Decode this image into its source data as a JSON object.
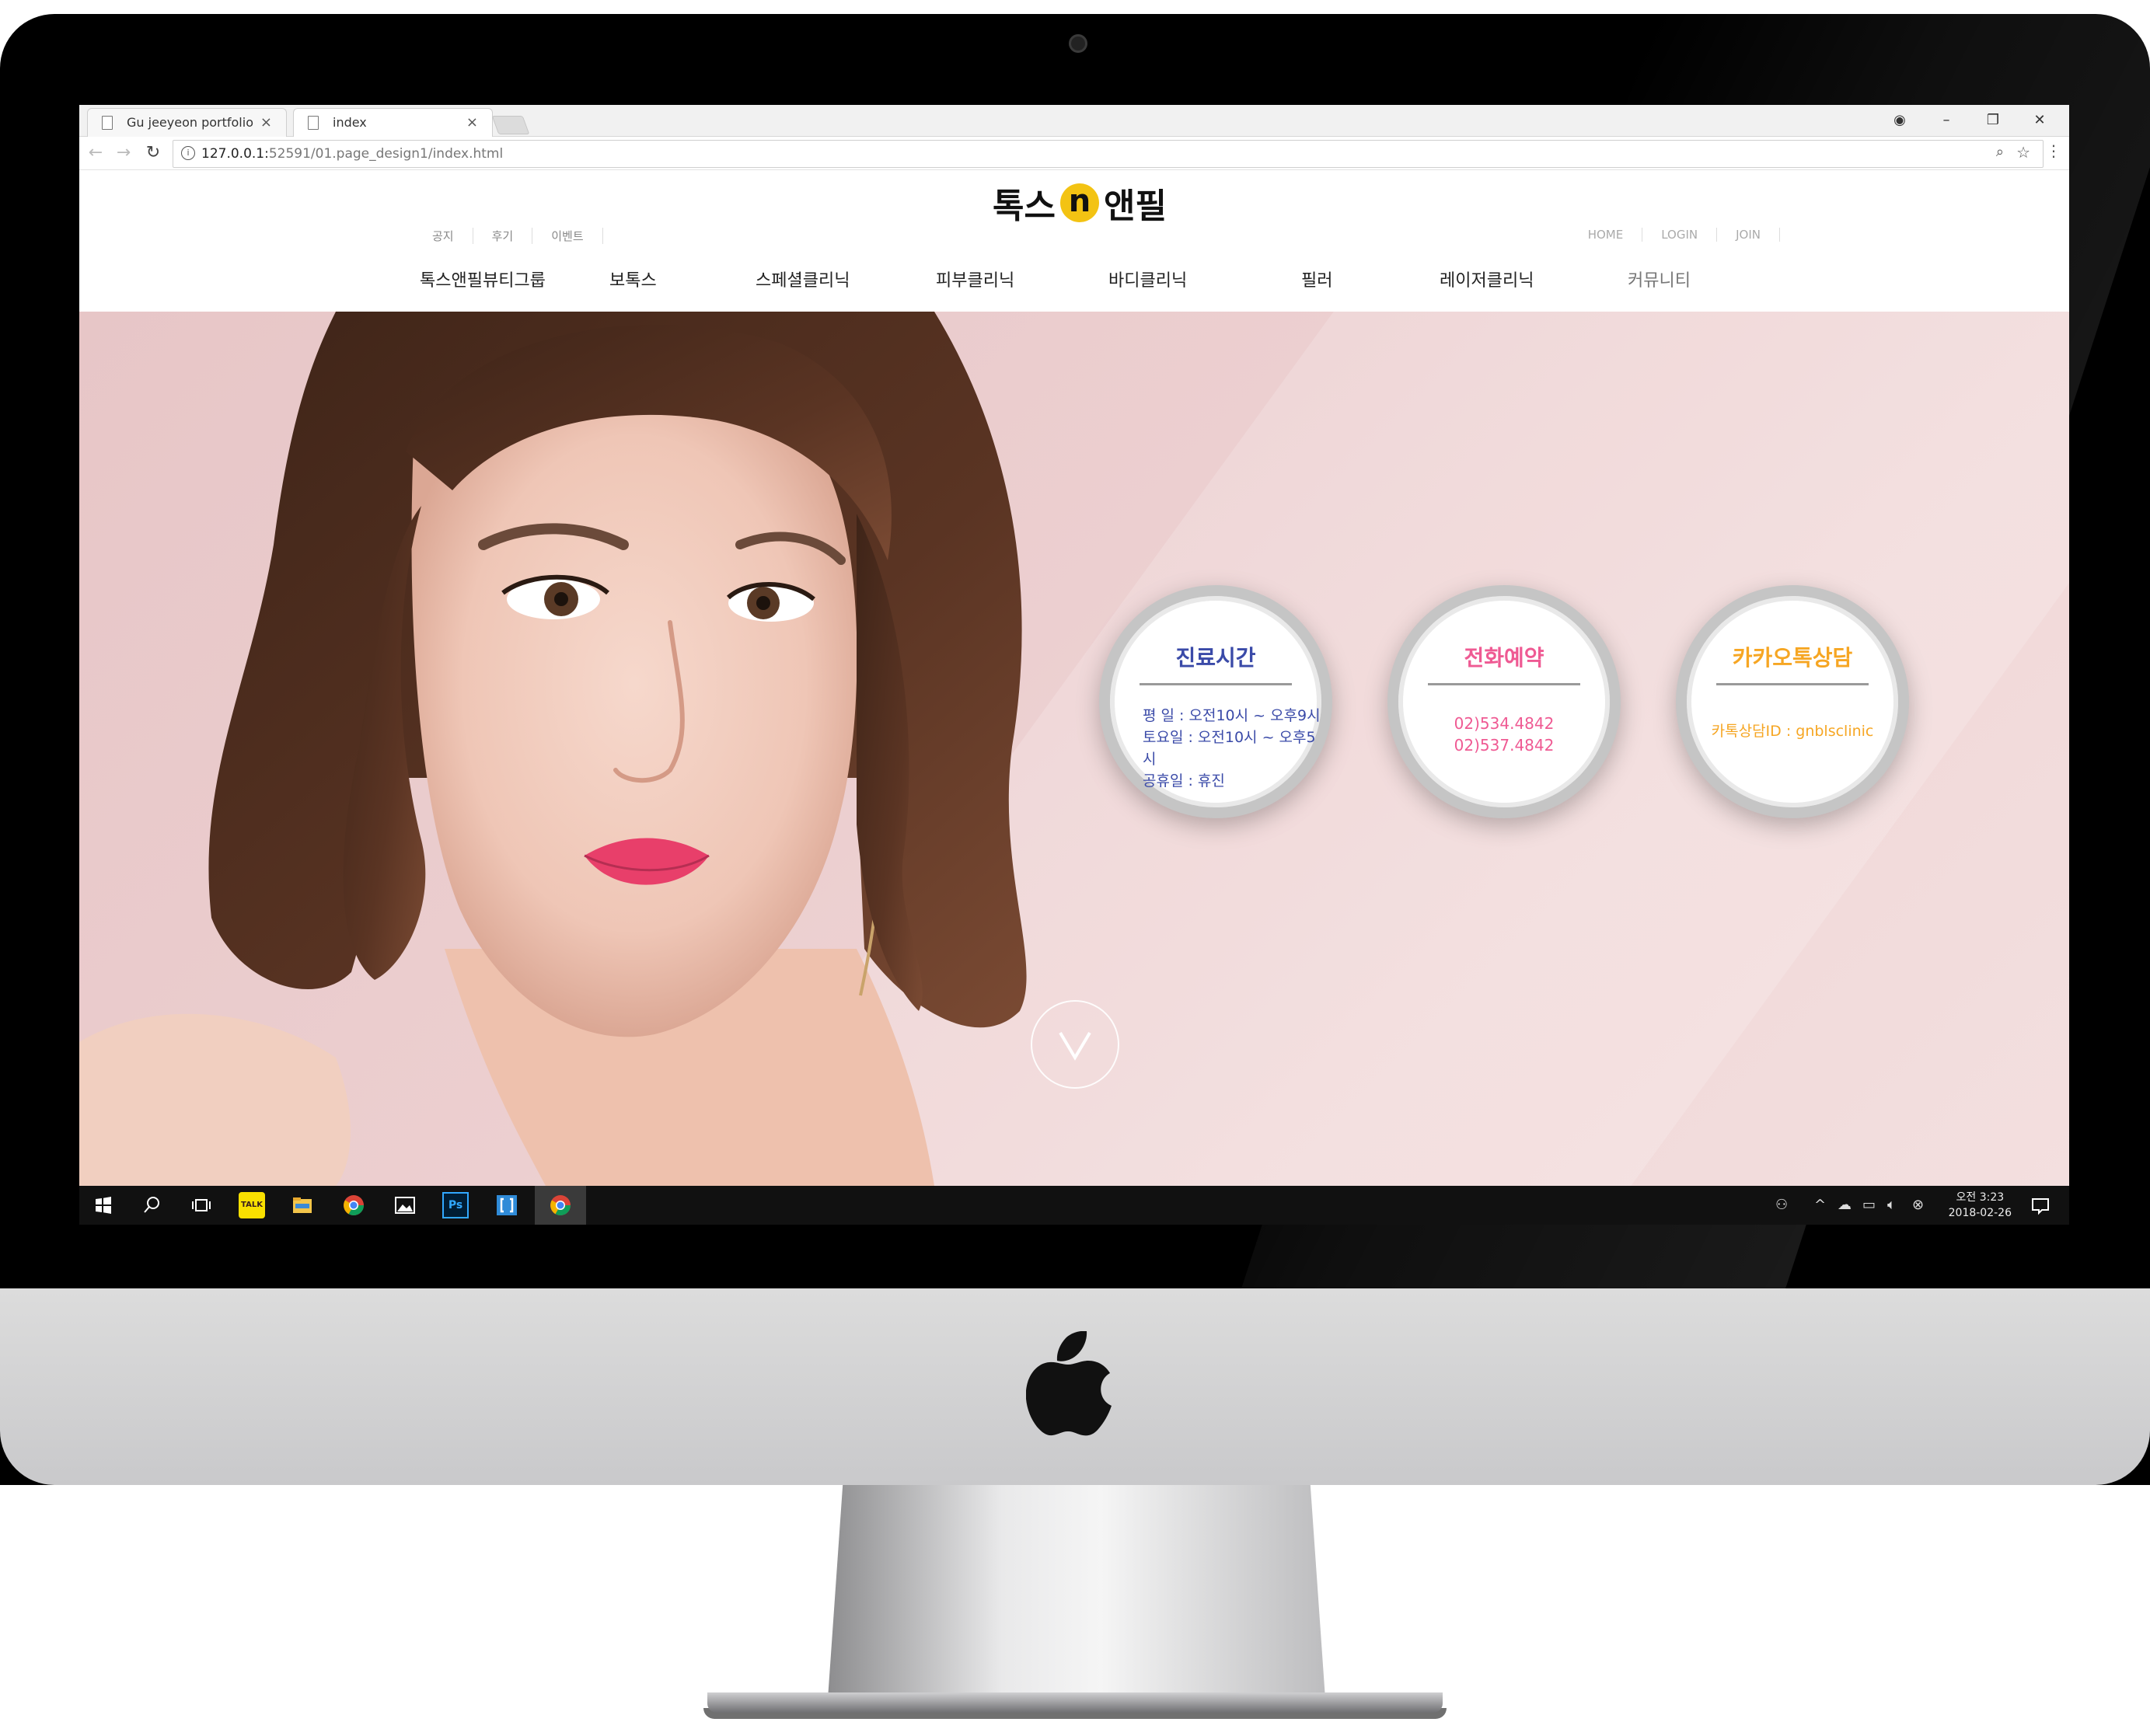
{
  "browser": {
    "tabs": [
      {
        "label": "Gu jeeyeon portfolio",
        "active": false
      },
      {
        "label": "index",
        "active": true
      }
    ],
    "url_host": "127.0.0.1:",
    "url_rest": "52591/01.page_design1/index.html",
    "window_controls": [
      "minimize",
      "restore",
      "close"
    ]
  },
  "site": {
    "logo_left": "톡스",
    "logo_mark": "n",
    "logo_right": "앤필",
    "top_links_left": [
      "공지",
      "후기",
      "이벤트"
    ],
    "top_links_right": [
      "HOME",
      "LOGIN",
      "JOIN"
    ],
    "gnb": [
      "톡스앤필뷰티그룹",
      "보톡스",
      "스페셜클리닉",
      "피부클리닉",
      "바디클리닉",
      "필러",
      "레이저클리닉",
      "커뮤니티"
    ],
    "info_circles": [
      {
        "title": "진료시간",
        "lines": [
          "평    일 : 오전10시 ~ 오후9시",
          "토요일 : 오전10시 ~ 오후5시",
          "공휴일 : 휴진"
        ],
        "color": "#3a4aa8"
      },
      {
        "title": "전화예약",
        "lines": [
          "02)534.4842",
          "02)537.4842"
        ],
        "color": "#ef5a93"
      },
      {
        "title": "카카오톡상담",
        "lines": [
          "카톡상담ID : gnblsclinic"
        ],
        "color": "#f6a623"
      }
    ],
    "scroll_button_icon": "chevron-down-icon"
  },
  "taskbar": {
    "apps": [
      "windows-start-icon",
      "search-icon",
      "task-view-icon",
      "kakaotalk-icon",
      "file-explorer-icon",
      "chrome-icon",
      "photos-icon",
      "photoshop-icon",
      "brackets-icon",
      "chrome-icon"
    ],
    "kakaotalk_label": "TALK",
    "photoshop_label": "Ps",
    "clock_time": "오전 3:23",
    "clock_date": "2018-02-26"
  },
  "colors": {
    "hero_pink": "#ebcdce",
    "logo_yellow": "#f3c313",
    "taskbar": "#111111"
  }
}
